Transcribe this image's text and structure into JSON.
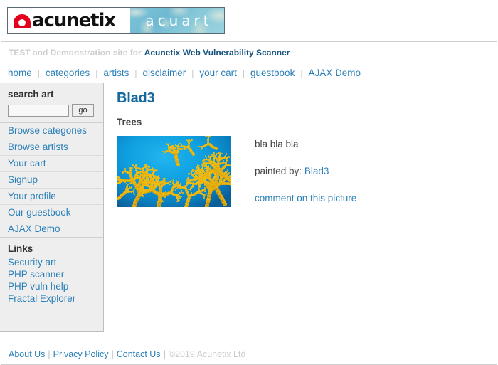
{
  "brand": {
    "logo_word": "acunetix",
    "logo_sub": "acuart",
    "logo_mark_icon": "acunetix-arch-logo-icon",
    "accent_red": "#e2001a",
    "link_blue": "#2a7fb8",
    "heading_blue": "#16699e"
  },
  "banner": {
    "dim_text": "TEST and Demonstration site for",
    "highlight_text": "Acunetix Web Vulnerability Scanner"
  },
  "topnav": {
    "items": [
      {
        "label": "home"
      },
      {
        "label": "categories"
      },
      {
        "label": "artists"
      },
      {
        "label": "disclaimer"
      },
      {
        "label": "your cart"
      },
      {
        "label": "guestbook"
      },
      {
        "label": "AJAX Demo"
      }
    ],
    "separator": "|"
  },
  "sidebar": {
    "search": {
      "title": "search art",
      "input_value": "",
      "input_placeholder": "",
      "button_label": "go"
    },
    "items": [
      {
        "label": "Browse categories"
      },
      {
        "label": "Browse artists"
      },
      {
        "label": "Your cart"
      },
      {
        "label": "Signup"
      },
      {
        "label": "Your profile"
      },
      {
        "label": "Our guestbook"
      },
      {
        "label": "AJAX Demo"
      }
    ],
    "links": {
      "title": "Links",
      "items": [
        {
          "label": "Security art"
        },
        {
          "label": "PHP scanner"
        },
        {
          "label": "PHP vuln help"
        },
        {
          "label": "Fractal Explorer"
        }
      ]
    }
  },
  "main": {
    "title": "Blad3",
    "subtitle": "Trees",
    "picture": {
      "alt_name": "fractal-artwork-image",
      "description": "bla bla bla",
      "painted_by_label": "painted by:",
      "painted_by_value": "Blad3",
      "comment_link": "comment on this picture"
    }
  },
  "footer": {
    "links": [
      {
        "label": "About Us"
      },
      {
        "label": "Privacy Policy"
      },
      {
        "label": "Contact Us"
      }
    ],
    "separator": "|",
    "copyright": "©2019 Acunetix Ltd"
  }
}
